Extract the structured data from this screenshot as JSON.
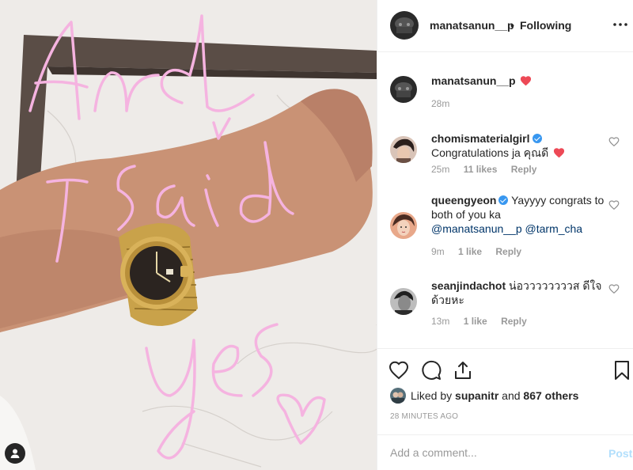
{
  "post": {
    "author": "manatsanun__p",
    "separator": "•",
    "follow_status": "Following",
    "more_icon": "more-horizontal-icon"
  },
  "caption": {
    "user": "manatsanun__p",
    "time": "28m"
  },
  "comments": [
    {
      "user": "chomismaterialgirl",
      "verified": true,
      "text": "Congratulations ja คุณดี",
      "time": "25m",
      "likes": "11 likes",
      "reply": "Reply"
    },
    {
      "user": "queengyeon",
      "verified": true,
      "text": "Yayyyy congrats to both of you ka",
      "mention1": "@manatsanun__p",
      "mention2": "@tarm_cha",
      "time": "9m",
      "likes": "1 like",
      "reply": "Reply"
    },
    {
      "user": "seanjindachot",
      "verified": false,
      "text": "น่อววววววววส ดีใจด้วยหะ",
      "time": "13m",
      "likes": "1 like",
      "reply": "Reply"
    }
  ],
  "engagement": {
    "liked_prefix": "Liked by",
    "liked_user": "supanitr",
    "liked_and": "and",
    "liked_others": "867 others",
    "timestamp": "28 MINUTES AGO"
  },
  "composer": {
    "placeholder": "Add a comment...",
    "post_label": "Post"
  },
  "photo": {
    "handwriting_line1": "And",
    "handwriting_line2": "I said",
    "handwriting_line3": "yes"
  },
  "colors": {
    "heart": "#ed4956",
    "verified": "#3897f0",
    "link": "#003569",
    "post_disabled": "#b2dffc",
    "handwriting": "#f5b3e0"
  }
}
